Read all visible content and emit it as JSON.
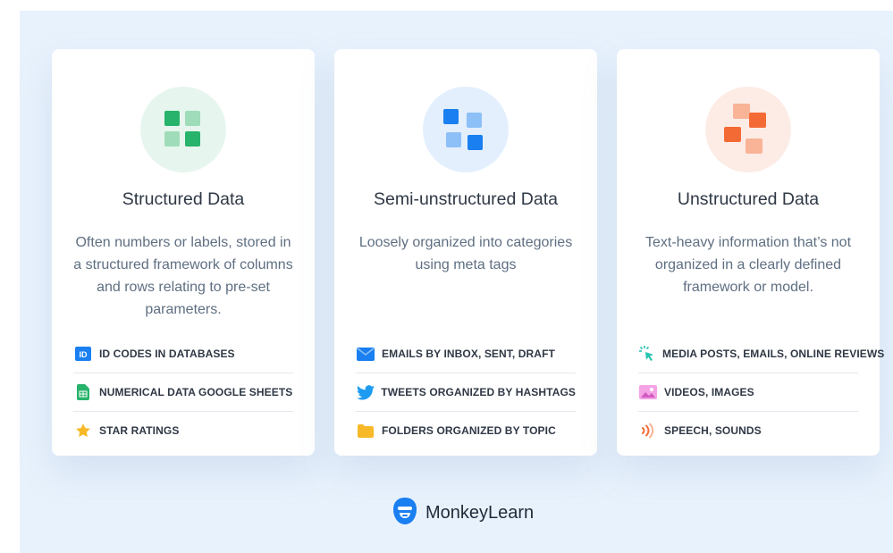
{
  "cards": [
    {
      "title": "Structured Data",
      "description": "Often numbers or labels, stored in a structured framework of columns and rows relating to pre-set parameters.",
      "icon": "green-squares-icon",
      "items": [
        {
          "label": "ID CODES IN DATABASES",
          "icon": "id-badge-icon"
        },
        {
          "label": "NUMERICAL DATA GOOGLE SHEETS",
          "icon": "google-sheets-icon"
        },
        {
          "label": "STAR RATINGS",
          "icon": "star-icon"
        }
      ]
    },
    {
      "title": "Semi-unstructured Data",
      "description": "Loosely organized into categories using meta tags",
      "icon": "blue-squares-icon",
      "items": [
        {
          "label": "EMAILS BY INBOX, SENT, DRAFT",
          "icon": "envelope-icon"
        },
        {
          "label": "TWEETS ORGANIZED BY HASHTAGS",
          "icon": "twitter-bird-icon"
        },
        {
          "label": "FOLDERS ORGANIZED BY TOPIC",
          "icon": "folder-icon"
        }
      ]
    },
    {
      "title": "Unstructured Data",
      "description": "Text-heavy information that’s not organized in a clearly defined framework or model.",
      "icon": "orange-squares-icon",
      "items": [
        {
          "label": "MEDIA POSTS, EMAILS, ONLINE REVIEWS",
          "icon": "click-cursor-icon"
        },
        {
          "label": "VIDEOS, IMAGES",
          "icon": "image-icon"
        },
        {
          "label": "SPEECH, SOUNDS",
          "icon": "sound-waves-icon"
        }
      ]
    }
  ],
  "brand": {
    "name": "MonkeyLearn",
    "logo": "monkeylearn-logo-icon"
  },
  "colors": {
    "background": "#e8f2fd",
    "green": "#27b36b",
    "blue": "#1a7ff0",
    "orange": "#f46a35"
  }
}
